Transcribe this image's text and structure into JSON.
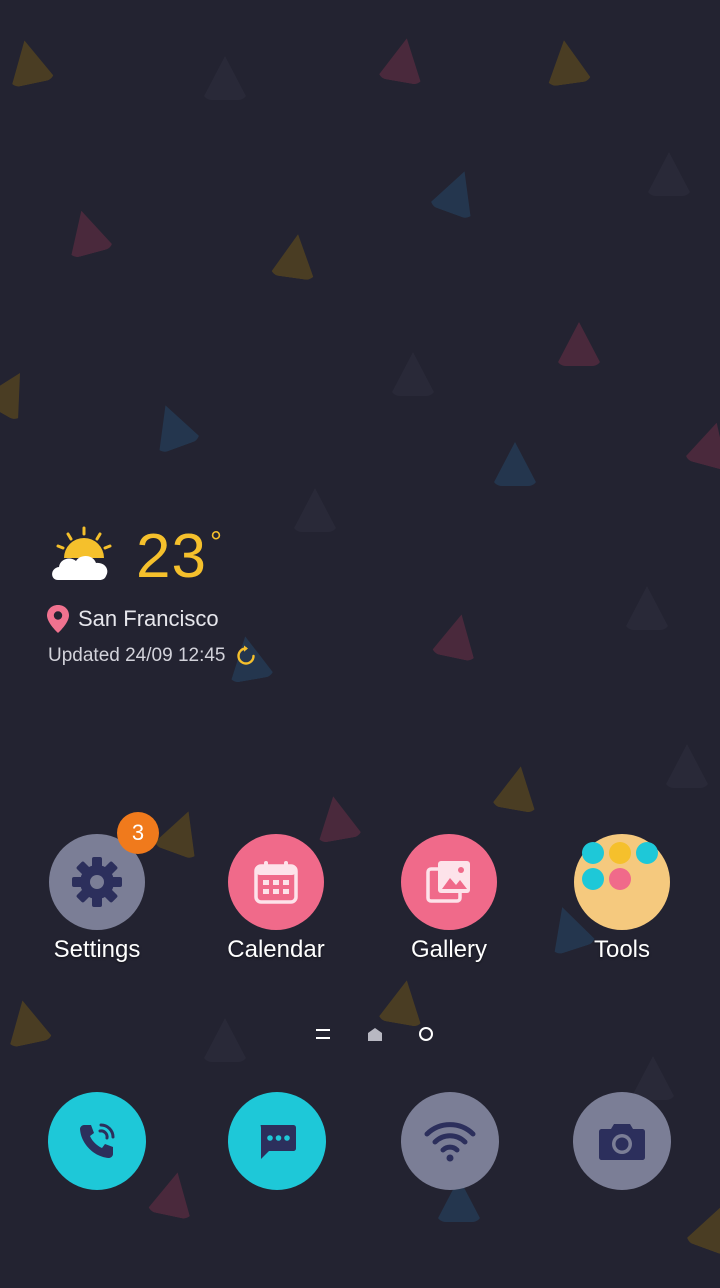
{
  "weather": {
    "temperature": "23",
    "unit": "°",
    "city": "San Francisco",
    "updated": "Updated 24/09 12:45",
    "icon": "partly-sunny-icon"
  },
  "apps": [
    {
      "label": "Settings",
      "icon": "gear-icon",
      "badge": "3",
      "color": "#7b7e96"
    },
    {
      "label": "Calendar",
      "icon": "calendar-icon",
      "color": "#f06a8a"
    },
    {
      "label": "Gallery",
      "icon": "gallery-icon",
      "color": "#f06a8a"
    },
    {
      "label": "Tools",
      "icon": "folder-icon",
      "color": "#f5c97e"
    }
  ],
  "dock": [
    {
      "icon": "phone-icon",
      "color": "#1ec8d8"
    },
    {
      "icon": "messages-icon",
      "color": "#1ec8d8"
    },
    {
      "icon": "wifi-icon",
      "color": "#7b7e96"
    },
    {
      "icon": "camera-icon",
      "color": "#7b7e96"
    }
  ],
  "colors": {
    "background": "#232331",
    "accent_yellow": "#f5c02c",
    "badge_orange": "#f07a1c",
    "icon_dark": "#2c2f5c"
  }
}
